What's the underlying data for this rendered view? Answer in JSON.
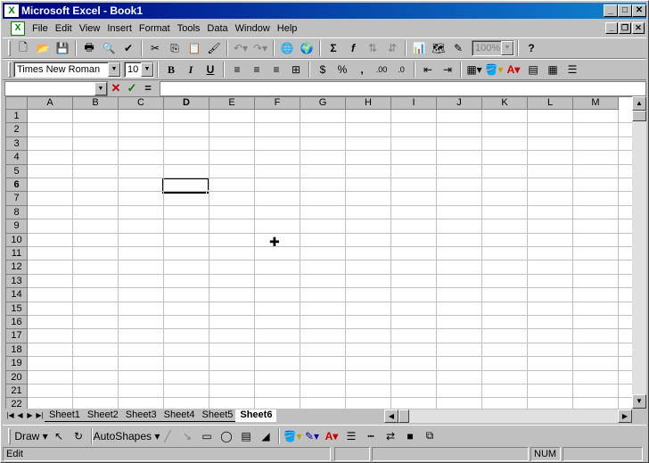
{
  "window": {
    "title": "Microsoft Excel - Book1",
    "app_icon": "X"
  },
  "menu": [
    "File",
    "Edit",
    "View",
    "Insert",
    "Format",
    "Tools",
    "Data",
    "Window",
    "Help"
  ],
  "font": {
    "name": "Times New Roman",
    "size": "10"
  },
  "zoom": "100%",
  "formula_bar": {
    "cancel": "✕",
    "enter": "✓",
    "equals": "="
  },
  "columns": [
    "A",
    "B",
    "C",
    "D",
    "E",
    "F",
    "G",
    "H",
    "I",
    "J",
    "K",
    "L",
    "M"
  ],
  "rows": [
    "1",
    "2",
    "3",
    "4",
    "5",
    "6",
    "7",
    "8",
    "9",
    "10",
    "11",
    "12",
    "13",
    "14",
    "15",
    "16",
    "17",
    "18",
    "19",
    "20",
    "21",
    "22"
  ],
  "active_cell": {
    "column": "D",
    "row": "6"
  },
  "sheets": [
    "Sheet1",
    "Sheet2",
    "Sheet3",
    "Sheet4",
    "Sheet5",
    "Sheet6"
  ],
  "active_sheet": "Sheet6",
  "draw_toolbar": {
    "draw": "Draw",
    "autoshapes": "AutoShapes"
  },
  "status": {
    "mode": "Edit",
    "num": "NUM"
  }
}
